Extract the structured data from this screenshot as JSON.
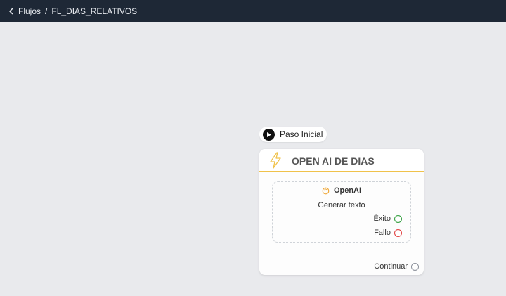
{
  "breadcrumb": {
    "back_label": "Flujos",
    "separator": "/",
    "current": "FL_DIAS_RELATIVOS"
  },
  "start_node": {
    "label": "Paso Inicial",
    "icon": "play-icon"
  },
  "node": {
    "title": "OPEN AI DE DIAS",
    "icon": "lightning-bolt-icon",
    "accent_color": "#f0c24a",
    "provider": "OpenAI",
    "provider_icon": "openai-icon",
    "action": "Generar texto",
    "outputs": [
      {
        "label": "Éxito",
        "color": "#2e9d3a"
      },
      {
        "label": "Fallo",
        "color": "#e03b3b"
      }
    ],
    "continue_label": "Continuar",
    "continue_color": "#8a8f99"
  }
}
